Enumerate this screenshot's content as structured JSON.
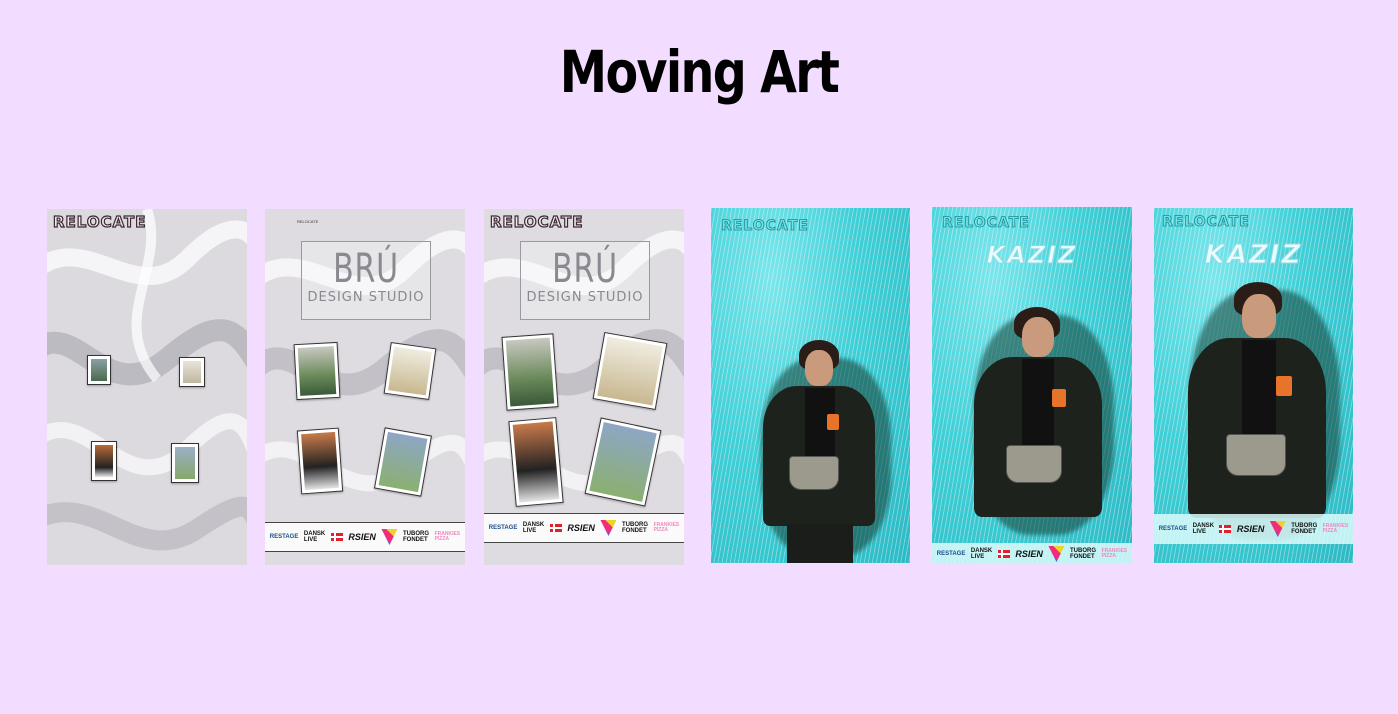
{
  "page": {
    "title": "Moving Art"
  },
  "panels": {
    "relocate_logo": "RELOCATE",
    "bru_title": "BRÚ",
    "bru_subtitle": "DESIGN STUDIO",
    "vogue_label": "VOGUE",
    "kaziz_label": "KAZIZ",
    "small_tag": "RELOCATE"
  },
  "sponsors": {
    "restage": "RESTAGE",
    "dansk_live_line1": "DANSK",
    "dansk_live_line2": "LIVE",
    "rsien": "RSIEN",
    "tuborg_line1": "TUBORG",
    "tuborg_line2": "FONDET",
    "frankies_line1": "FRANKIES",
    "frankies_line2": "PIZZA"
  },
  "colors": {
    "background": "#f2dcff",
    "cyan_bg": "#3fcfd6",
    "grey_bg": "#d9d7dd"
  }
}
